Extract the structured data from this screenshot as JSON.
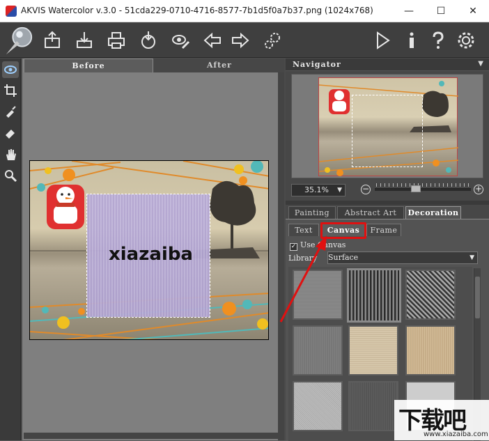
{
  "window": {
    "title": "AKVIS Watercolor v.3.0 - 51cda229-0710-4716-8577-7b1d5f0a7b37.png (1024x768)",
    "minimize": "—",
    "maximize": "☐",
    "close": "✕"
  },
  "toolbar": {
    "icons": [
      "open-icon",
      "save-icon",
      "print-icon",
      "share-icon",
      "preferences-icon",
      "back-icon",
      "forward-icon",
      "batch-icon",
      "run-icon",
      "info-icon",
      "help-icon",
      "settings-icon"
    ]
  },
  "tools": [
    "preview-tool",
    "crop-tool",
    "brush-tool",
    "eraser-tool",
    "hand-tool",
    "zoom-tool"
  ],
  "canvas": {
    "tab_before": "Before",
    "tab_after": "After",
    "overlay_text": "xiazaiba"
  },
  "navigator": {
    "title": "Navigator",
    "zoom": "35.1%"
  },
  "settings": {
    "tabs": [
      "Painting",
      "Abstract Art",
      "Decoration"
    ],
    "active_tab": "Decoration",
    "subtabs": [
      "Text",
      "Canvas",
      "Frame"
    ],
    "active_subtab": "Canvas",
    "use_canvas_label": "Use Canvas",
    "use_canvas_checked": true,
    "library_label": "Library",
    "library_value": "Surface"
  },
  "watermark": {
    "text": "下载吧",
    "url": "www.xiazaiba.com"
  },
  "colors": {
    "highlight": "#e01010"
  }
}
